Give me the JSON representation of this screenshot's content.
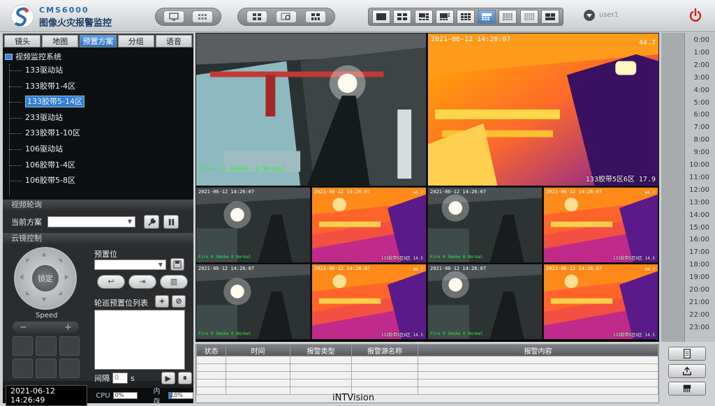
{
  "header": {
    "brand_top": "CMS6000",
    "brand_title": "图像火灾报警监控",
    "username": "user1",
    "layout_buttons": [
      "1",
      "4",
      "6",
      "8",
      "9",
      "12",
      "16",
      "25",
      "custom"
    ],
    "active_layout": 5
  },
  "left": {
    "tabs": [
      "镜头",
      "地图",
      "预置方案",
      "分组",
      "语音"
    ],
    "active_tab": 2,
    "tree_root": "视频监控系统",
    "tree_items": [
      "133驱动站",
      "133胶带1-4区",
      "133胶带5-14区",
      "233驱动站",
      "233胶带1-10区",
      "106驱动站",
      "106胶带1-4区",
      "106胶带5-8区"
    ],
    "selected_item": 2,
    "section_patrol": "视频轮询",
    "current_plan_label": "当前方案",
    "section_ptz": "云镜控制",
    "lock_label": "锁定",
    "speed_label": "Speed",
    "speed_minus": "−",
    "speed_plus": "+",
    "preset_label": "预置位",
    "cruise_label": "轮巡预置位列表",
    "interval_label": "间隔",
    "interval_value": "0",
    "interval_unit": "s"
  },
  "status": {
    "datetime": "2021-06-12   14:26:49",
    "cpu_label": "CPU",
    "cpu_value": "0%",
    "cpu_fraction": 0.0,
    "mem_label": "内存",
    "mem_value": "10%",
    "mem_fraction": 0.1
  },
  "video": {
    "big_left_green": "Fire: 0  Smoke: 0  Normal",
    "big_right_ts": "2021-06-12  14:26:07",
    "big_right_temp": "44.7",
    "big_right_caption": "133胶带5区6区 17.9",
    "small_ts": "2021-06-12  14:26:07",
    "small_green": "Fire 0 Smoke 0 Normal",
    "small_cap": "133胶带5区6区 14.5",
    "small_temp": "44.7"
  },
  "timeline": [
    "0:00",
    "1:00",
    "2:00",
    "3:00",
    "4:00",
    "5:00",
    "6:00",
    "7:00",
    "8:00",
    "9:00",
    "10:00",
    "11:00",
    "12:00",
    "13:00",
    "14:00",
    "15:00",
    "16:00",
    "17:00",
    "18:00",
    "19:00",
    "20:00",
    "21:00",
    "22:00",
    "23:00"
  ],
  "alarm_table": {
    "headers": [
      "状态",
      "时间",
      "报警类型",
      "报警源名称",
      "报警内容"
    ]
  },
  "footer": "iNTVision"
}
